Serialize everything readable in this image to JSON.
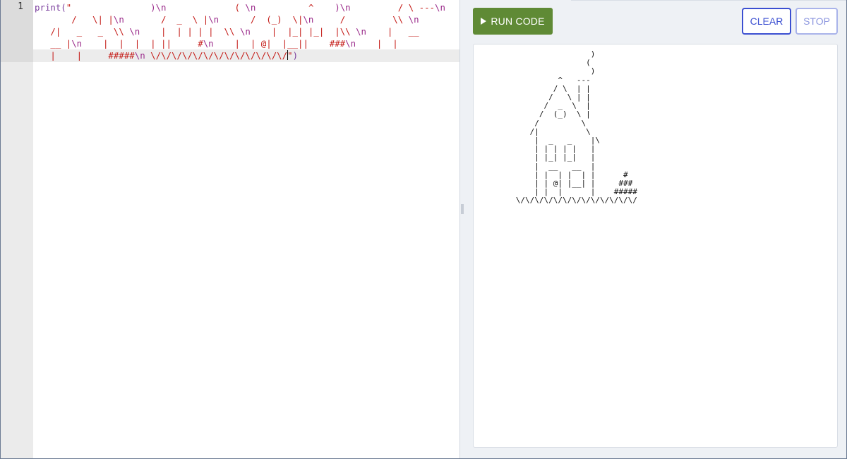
{
  "editor": {
    "line_number": "1",
    "code": {
      "prefix": "print(\"",
      "string_body": "               )\\n              ( \\n          ^    )\\n         / \\ ---\\n        /   \\| |\\n       /  _  \\ |\\n      /  (_)  \\|\\n     /         \\\\ \\n    /|   _   _  \\\\ \\n     |  | | | |  \\\\ \\n     |  |_| |_|  |\\\\ \\n     |    __     |\\n     |  |  |  | ||     #\\n     |  | @|  |__||    ###\\n     |  |  |       |  #####\\n \\/\\/\\/\\/\\/\\/\\/\\/\\/\\/\\/\\/\\/\\/",
      "suffix": "\")"
    },
    "display_lines": [
      [
        {
          "t": "fn",
          "v": "print("
        },
        {
          "t": "str",
          "v": "\"               "
        },
        {
          "t": "esc",
          "v": ")\\n"
        },
        {
          "t": "str",
          "v": "             ( "
        },
        {
          "t": "esc",
          "v": "\\n"
        },
        {
          "t": "str",
          "v": "          ^    "
        },
        {
          "t": "esc",
          "v": ")\\n"
        },
        {
          "t": "str",
          "v": "         / \\ ---"
        },
        {
          "t": "esc",
          "v": "\\n"
        }
      ],
      [
        {
          "t": "str",
          "v": "       /   \\| |"
        },
        {
          "t": "esc",
          "v": "\\n"
        },
        {
          "t": "str",
          "v": "       /  _  \\ |"
        },
        {
          "t": "esc",
          "v": "\\n"
        },
        {
          "t": "str",
          "v": "      /  (_)  \\|"
        },
        {
          "t": "esc",
          "v": "\\n"
        },
        {
          "t": "str",
          "v": "     /         \\\\ "
        },
        {
          "t": "esc",
          "v": "\\n"
        }
      ],
      [
        {
          "t": "str",
          "v": "   /|   _   _  \\\\ "
        },
        {
          "t": "esc",
          "v": "\\n"
        },
        {
          "t": "str",
          "v": "    |  | | | |  \\\\ "
        },
        {
          "t": "esc",
          "v": "\\n"
        },
        {
          "t": "str",
          "v": "    |  |_| |_|  |\\\\ "
        },
        {
          "t": "esc",
          "v": "\\n"
        },
        {
          "t": "str",
          "v": "    |   __"
        }
      ],
      [
        {
          "t": "str",
          "v": "   __ |"
        },
        {
          "t": "esc",
          "v": "\\n"
        },
        {
          "t": "str",
          "v": "    |  |  |  | ||     #"
        },
        {
          "t": "esc",
          "v": "\\n"
        },
        {
          "t": "str",
          "v": "    |  | @|  |__||    ###"
        },
        {
          "t": "esc",
          "v": "\\n"
        },
        {
          "t": "str",
          "v": "    |  |"
        }
      ],
      [
        {
          "t": "str",
          "v": "   |    |     #####"
        },
        {
          "t": "esc",
          "v": "\\n"
        },
        {
          "t": "str",
          "v": " \\/\\/\\/\\/\\/\\/\\/\\/\\/\\/\\/\\/\\/"
        },
        {
          "t": "caret",
          "v": ""
        },
        {
          "t": "str",
          "v": "\""
        },
        {
          "t": "fn",
          "v": ")"
        }
      ]
    ]
  },
  "toolbar": {
    "run_label": "RUN CODE",
    "clear_label": "CLEAR",
    "stop_label": "STOP"
  },
  "console": {
    "output": "                      )\n                     (\n                      )\n               ^   ---\n              / \\  | |\n             /   \\ | |\n            /  _  \\  |\n           /  (_)  \\ |\n          /         \\\n         /|          \\\n          |  _   _    |\\\n          | | | | |   |\n          | |_| |_|   |\n          |  __   __  |\n          | |  | |  | |      #\n          | | @| |__| |     ###\n          | |  |      |    #####\n      \\/\\/\\/\\/\\/\\/\\/\\/\\/\\/\\/\\/\\/"
  },
  "colors": {
    "run": "#5f8a35",
    "clear": "#3b4fd1",
    "stop": "#a9b3ea",
    "panel_bg": "#eef1f5"
  }
}
